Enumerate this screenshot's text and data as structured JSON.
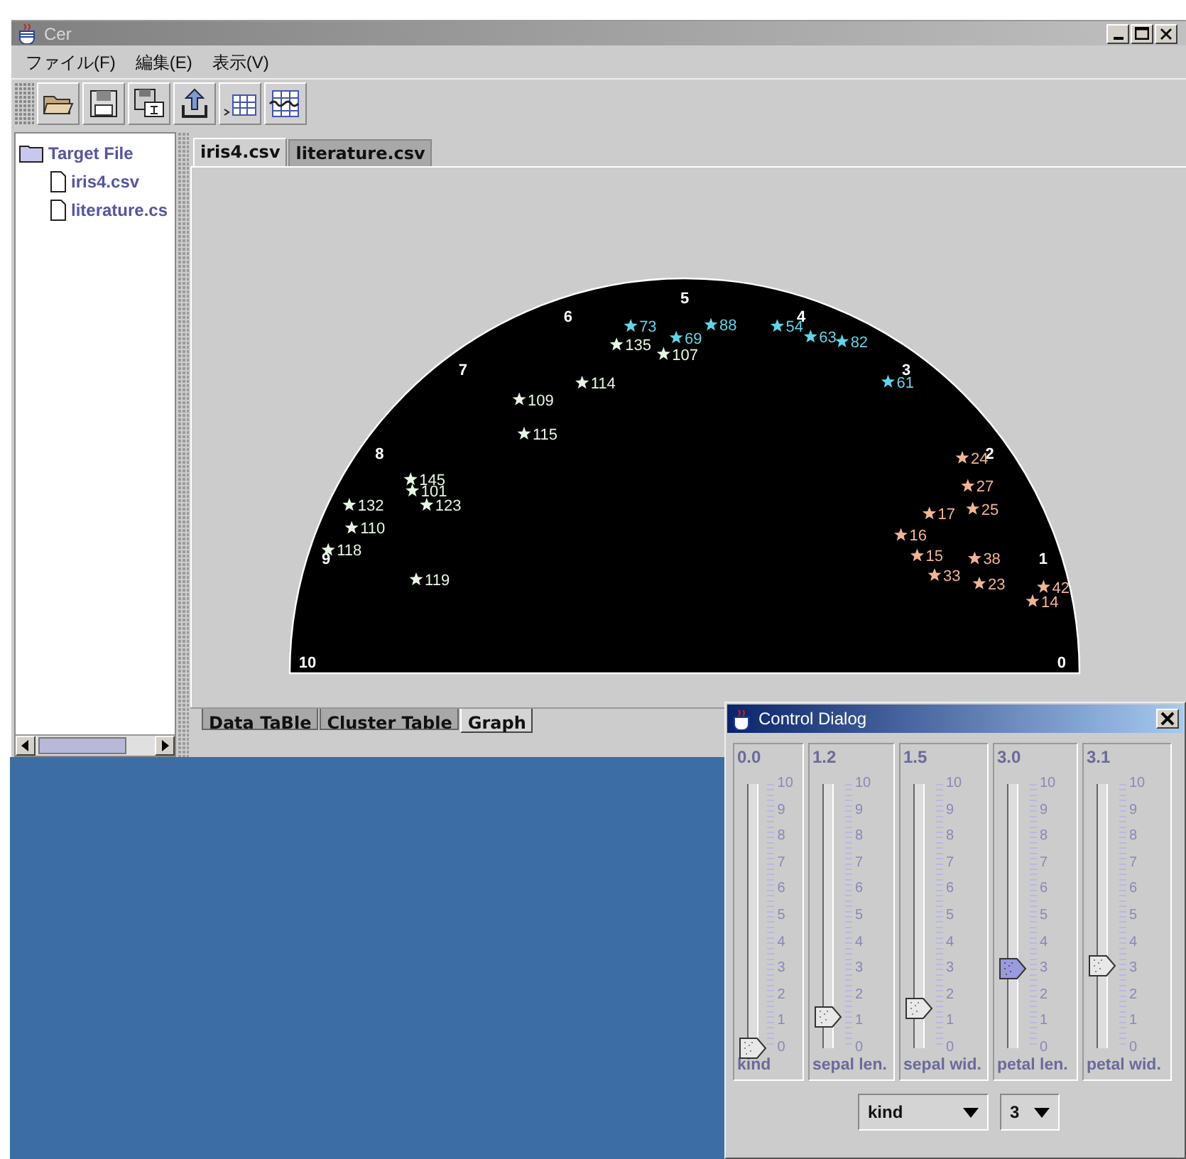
{
  "window": {
    "title": "Cer"
  },
  "menu": [
    "ファイル(F)",
    "編集(E)",
    "表示(V)"
  ],
  "tree": {
    "label": "Target File",
    "children": [
      {
        "label": "iris4.csv"
      },
      {
        "label": "literature.cs"
      }
    ]
  },
  "file_tabs": [
    {
      "label": "iris4.csv",
      "selected": true
    },
    {
      "label": "literature.csv",
      "selected": false
    }
  ],
  "graph": {
    "arc_labels": [
      "0",
      "1",
      "2",
      "3",
      "4",
      "5",
      "6",
      "7",
      "8",
      "9",
      "10"
    ],
    "points": [
      {
        "label": "119",
        "color": "#e6f6e2"
      },
      {
        "label": "118",
        "color": "#e6f6e2"
      },
      {
        "label": "110",
        "color": "#e6f6e2"
      },
      {
        "label": "132",
        "color": "#e6f6e2"
      },
      {
        "label": "123",
        "color": "#e6f6e2"
      },
      {
        "label": "145",
        "color": "#e6f6e2"
      },
      {
        "label": "101",
        "color": "#e6f6e2"
      },
      {
        "label": "115",
        "color": "#e6f6e2"
      },
      {
        "label": "109",
        "color": "#e6f6e2"
      },
      {
        "label": "114",
        "color": "#e6f6e2"
      },
      {
        "label": "135",
        "color": "#e6f6e2"
      },
      {
        "label": "107",
        "color": "#e6f6e2"
      },
      {
        "label": "73",
        "color": "#5fd6e8"
      },
      {
        "label": "69",
        "color": "#5fd6e8"
      },
      {
        "label": "88",
        "color": "#5fd6e8"
      },
      {
        "label": "54",
        "color": "#5fd6e8"
      },
      {
        "label": "63",
        "color": "#5fd6e8"
      },
      {
        "label": "61",
        "color": "#5fd6e8"
      },
      {
        "label": "82",
        "color": "#5fd6e8"
      },
      {
        "label": "14",
        "color": "#f2b494"
      },
      {
        "label": "23",
        "color": "#f2b494"
      },
      {
        "label": "33",
        "color": "#f2b494"
      },
      {
        "label": "38",
        "color": "#f2b494"
      },
      {
        "label": "16",
        "color": "#f2b494"
      },
      {
        "label": "17",
        "color": "#f2b494"
      },
      {
        "label": "24",
        "color": "#f2b494"
      },
      {
        "label": "27",
        "color": "#f2b494"
      },
      {
        "label": "25",
        "color": "#f2b494"
      },
      {
        "label": "42",
        "color": "#f2b494"
      },
      {
        "label": "15",
        "color": "#f2b494"
      }
    ]
  },
  "view_tabs": [
    {
      "label": "Data TaBle",
      "selected": false
    },
    {
      "label": "Cluster Table",
      "selected": false
    },
    {
      "label": "Graph",
      "selected": true
    }
  ],
  "control_dialog": {
    "title": "Control Dialog",
    "sliders": [
      {
        "reading": "0.0",
        "label": "kind",
        "level": 0.0,
        "focused": false,
        "scale": [
          "10",
          "9",
          "8",
          "7",
          "6",
          "5",
          "4",
          "3",
          "2",
          "1",
          "0"
        ]
      },
      {
        "reading": "1.2",
        "label": "sepal len.",
        "level": 0.12,
        "focused": false,
        "scale": [
          "10",
          "9",
          "8",
          "7",
          "6",
          "5",
          "4",
          "3",
          "2",
          "1",
          "0"
        ]
      },
      {
        "reading": "1.5",
        "label": "sepal wid.",
        "level": 0.15,
        "focused": false,
        "scale": [
          "10",
          "9",
          "8",
          "7",
          "6",
          "5",
          "4",
          "3",
          "2",
          "1",
          "0"
        ]
      },
      {
        "reading": "3.0",
        "label": "petal len.",
        "level": 0.3,
        "focused": true,
        "scale": [
          "10",
          "9",
          "8",
          "7",
          "6",
          "5",
          "4",
          "3",
          "2",
          "1",
          "0"
        ]
      },
      {
        "reading": "3.1",
        "label": "petal wid.",
        "level": 0.31,
        "focused": false,
        "scale": [
          "10",
          "9",
          "8",
          "7",
          "6",
          "5",
          "4",
          "3",
          "2",
          "1",
          "0"
        ]
      }
    ],
    "combos": [
      {
        "value": "kind"
      },
      {
        "value": "3"
      }
    ]
  }
}
